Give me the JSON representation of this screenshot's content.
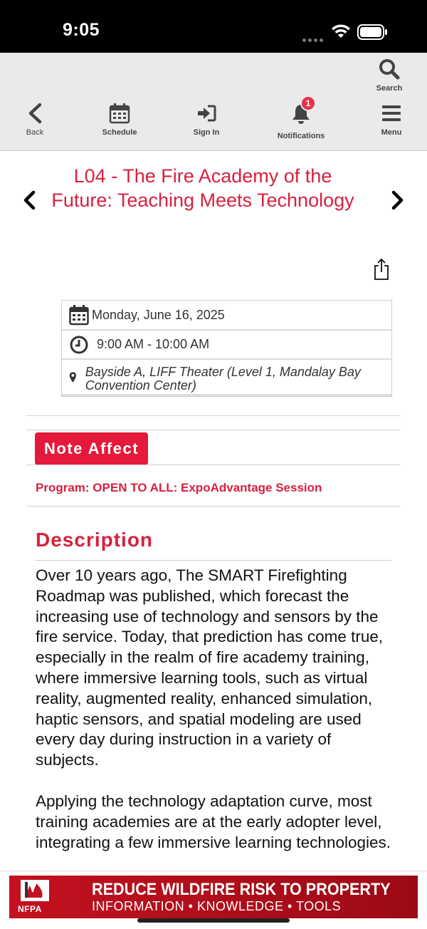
{
  "status_bar": {
    "time": "9:05"
  },
  "toolbar": {
    "search_label": "Search",
    "back_label": "Back",
    "schedule_label": "Schedule",
    "signin_label": "Sign In",
    "notifications_label": "Notifications",
    "notifications_count": "1",
    "menu_label": "Menu"
  },
  "session": {
    "title": "L04 - The Fire Academy of the Future: Teaching Meets Technology",
    "date": "Monday, June 16, 2025",
    "time": "9:00 AM - 10:00 AM",
    "location": "Bayside A, LIFF Theater (Level 1, Mandalay Bay Convention Center)",
    "badge": "Note Affect",
    "program": "Program: OPEN TO ALL: ExpoAdvantage Session"
  },
  "description": {
    "heading": "Description",
    "paragraphs": [
      "Over 10 years ago, The SMART Firefighting Roadmap was published, which forecast the increasing use of technology and sensors by the fire service. Today, that prediction has come true, especially in the realm of fire academy training, where immersive learning tools, such as virtual reality, augmented reality, enhanced simulation, haptic sensors, and spatial modeling are used every day during instruction in a variety of subjects.",
      "Applying the technology adaptation curve, most training academies are at the early adopter level, integrating a few immersive learning technologies."
    ]
  },
  "ad": {
    "logo_text": "NFPA",
    "headline": "REDUCE WILDFIRE RISK TO PROPERTY",
    "subline": "INFORMATION • KNOWLEDGE • TOOLS"
  },
  "colors": {
    "accent": "#d8203e",
    "badge_bg": "#e5193b",
    "toolbar_bg": "#eaeaea",
    "ad_bg": "#c4111f"
  },
  "icons": [
    "search-icon",
    "back-chevron-icon",
    "calendar-icon",
    "sign-in-icon",
    "bell-icon",
    "hamburger-menu-icon",
    "chevron-left-icon",
    "chevron-right-icon",
    "share-icon",
    "clock-icon",
    "map-pin-icon"
  ]
}
